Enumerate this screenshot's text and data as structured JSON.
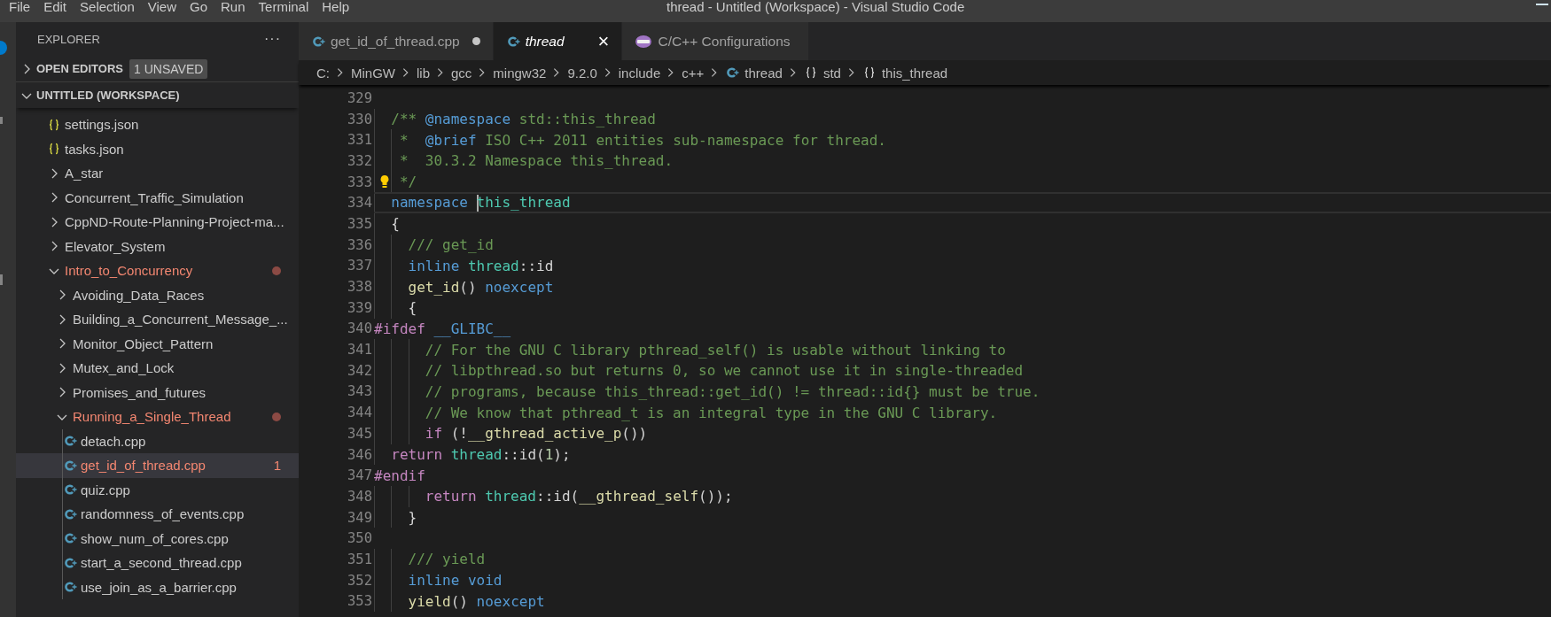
{
  "title_bar": {
    "menu": [
      "File",
      "Edit",
      "Selection",
      "View",
      "Go",
      "Run",
      "Terminal",
      "Help"
    ],
    "title": "thread - Untitled (Workspace) - Visual Studio Code"
  },
  "sidebar": {
    "title": "EXPLORER",
    "more": "···",
    "sections": [
      {
        "label": "OPEN EDITORS",
        "expanded": false,
        "badge": "1 UNSAVED"
      },
      {
        "label": "UNTITLED (WORKSPACE)",
        "expanded": true
      }
    ],
    "tree": [
      {
        "label": "settings.json",
        "kind": "json",
        "selected": false,
        "modified": false
      },
      {
        "label": "tasks.json",
        "kind": "json",
        "selected": false,
        "modified": false
      },
      {
        "label": "A_star",
        "kind": "folder",
        "expanded": false,
        "selected": false,
        "modified": false
      },
      {
        "label": "Concurrent_Traffic_Simulation",
        "kind": "folder",
        "expanded": false,
        "selected": false,
        "modified": false
      },
      {
        "label": "CppND-Route-Planning-Project-ma...",
        "kind": "folder",
        "expanded": false,
        "selected": false,
        "modified": false
      },
      {
        "label": "Elevator_System",
        "kind": "folder",
        "expanded": false,
        "selected": false,
        "modified": false
      },
      {
        "label": "Intro_to_Concurrency",
        "kind": "folder",
        "expanded": true,
        "selected": false,
        "modified": true,
        "children": [
          {
            "label": "Avoiding_Data_Races",
            "kind": "folder",
            "expanded": false,
            "selected": false,
            "modified": false
          },
          {
            "label": "Building_a_Concurrent_Message_...",
            "kind": "folder",
            "expanded": false,
            "selected": false,
            "modified": false
          },
          {
            "label": "Monitor_Object_Pattern",
            "kind": "folder",
            "expanded": false,
            "selected": false,
            "modified": false
          },
          {
            "label": "Mutex_and_Lock",
            "kind": "folder",
            "expanded": false,
            "selected": false,
            "modified": false
          },
          {
            "label": "Promises_and_futures",
            "kind": "folder",
            "expanded": false,
            "selected": false,
            "modified": false
          },
          {
            "label": "Running_a_Single_Thread",
            "kind": "folder",
            "expanded": true,
            "selected": false,
            "modified": true,
            "children": [
              {
                "label": "detach.cpp",
                "kind": "cpp",
                "selected": false,
                "modified": false
              },
              {
                "label": "get_id_of_thread.cpp",
                "kind": "cpp",
                "selected": true,
                "modified": true,
                "badge": "1"
              },
              {
                "label": "quiz.cpp",
                "kind": "cpp",
                "selected": false,
                "modified": false
              },
              {
                "label": "randomness_of_events.cpp",
                "kind": "cpp",
                "selected": false,
                "modified": false
              },
              {
                "label": "show_num_of_cores.cpp",
                "kind": "cpp",
                "selected": false,
                "modified": false
              },
              {
                "label": "start_a_second_thread.cpp",
                "kind": "cpp",
                "selected": false,
                "modified": false
              },
              {
                "label": "use_join_as_a_barrier.cpp",
                "kind": "cpp",
                "selected": false,
                "modified": false
              }
            ]
          }
        ]
      }
    ]
  },
  "tabs": [
    {
      "label": "get_id_of_thread.cpp",
      "kind": "cpp",
      "selected": false,
      "dirty": true,
      "preview": false
    },
    {
      "label": "thread",
      "kind": "cpp",
      "selected": true,
      "dirty": false,
      "preview": true,
      "close": "×"
    },
    {
      "label": "C/C++ Configurations",
      "kind": "config",
      "selected": false,
      "dirty": false,
      "preview": false
    }
  ],
  "breadcrumbs": [
    {
      "label": "C:",
      "kind": "folder"
    },
    {
      "label": "MinGW",
      "kind": "folder"
    },
    {
      "label": "lib",
      "kind": "folder"
    },
    {
      "label": "gcc",
      "kind": "folder"
    },
    {
      "label": "mingw32",
      "kind": "folder"
    },
    {
      "label": "9.2.0",
      "kind": "folder"
    },
    {
      "label": "include",
      "kind": "folder"
    },
    {
      "label": "c++",
      "kind": "folder"
    },
    {
      "label": "thread",
      "kind": "cpp"
    },
    {
      "label": "std",
      "kind": "namespace"
    },
    {
      "label": "this_thread",
      "kind": "namespace"
    }
  ],
  "editor": {
    "lines": [
      {
        "number": "329"
      },
      {
        "number": "330",
        "tokens": [
          {
            "kind": "comment",
            "text": "  /** "
          },
          {
            "kind": "doctag",
            "text": "@namespace"
          },
          {
            "kind": "comment",
            "text": " std::this_thread"
          }
        ]
      },
      {
        "number": "331",
        "tokens": [
          {
            "kind": "comment",
            "text": "   *  "
          },
          {
            "kind": "doctag",
            "text": "@brief"
          },
          {
            "kind": "comment",
            "text": " ISO C++ 2011 entities sub-namespace for thread."
          }
        ]
      },
      {
        "number": "332",
        "tokens": [
          {
            "kind": "comment",
            "text": "   *  30.3.2 Namespace this_thread."
          }
        ]
      },
      {
        "number": "333",
        "lightbulb": true,
        "tokens": [
          {
            "kind": "comment",
            "text": "   */"
          }
        ]
      },
      {
        "number": "334",
        "current": true,
        "tokens": [
          {
            "kind": "keyword",
            "text": "  namespace "
          },
          {
            "kind": "type",
            "text": "this_thread",
            "cursor": true
          }
        ]
      },
      {
        "number": "335",
        "tokens": [
          {
            "kind": "plain",
            "text": "  {"
          }
        ]
      },
      {
        "number": "336",
        "tokens": [
          {
            "kind": "comment",
            "text": "    /// get_id"
          }
        ]
      },
      {
        "number": "337",
        "tokens": [
          {
            "kind": "keyword",
            "text": "    inline "
          },
          {
            "kind": "type",
            "text": "thread"
          },
          {
            "kind": "plain",
            "text": "::id"
          }
        ]
      },
      {
        "number": "338",
        "tokens": [
          {
            "kind": "function",
            "text": "    get_id"
          },
          {
            "kind": "plain",
            "text": "() "
          },
          {
            "kind": "keyword",
            "text": "noexcept"
          }
        ]
      },
      {
        "number": "339",
        "tokens": [
          {
            "kind": "plain",
            "text": "    {"
          }
        ]
      },
      {
        "number": "340",
        "tokens": [
          {
            "kind": "preproc",
            "text": "#ifdef "
          },
          {
            "kind": "macro",
            "text": "__GLIBC__"
          }
        ]
      },
      {
        "number": "341",
        "tokens": [
          {
            "kind": "comment",
            "text": "      // For the GNU C library pthread_self() is usable without linking to"
          }
        ]
      },
      {
        "number": "342",
        "tokens": [
          {
            "kind": "comment",
            "text": "      // libpthread.so but returns 0, so we cannot use it in single-threaded"
          }
        ]
      },
      {
        "number": "343",
        "tokens": [
          {
            "kind": "comment",
            "text": "      // programs, because this_thread::get_id() != thread::id{} must be true."
          }
        ]
      },
      {
        "number": "344",
        "tokens": [
          {
            "kind": "comment",
            "text": "      // We know that pthread_t is an integral type in the GNU C library."
          }
        ]
      },
      {
        "number": "345",
        "tokens": [
          {
            "kind": "control",
            "text": "      if"
          },
          {
            "kind": "plain",
            "text": " (!"
          },
          {
            "kind": "function",
            "text": "__gthread_active_p"
          },
          {
            "kind": "plain",
            "text": "())"
          }
        ]
      },
      {
        "number": "346",
        "tokens": [
          {
            "kind": "control",
            "text": "  return "
          },
          {
            "kind": "type",
            "text": "thread"
          },
          {
            "kind": "plain",
            "text": "::id("
          },
          {
            "kind": "number",
            "text": "1"
          },
          {
            "kind": "plain",
            "text": ");"
          }
        ]
      },
      {
        "number": "347",
        "tokens": [
          {
            "kind": "preproc",
            "text": "#endif"
          }
        ]
      },
      {
        "number": "348",
        "tokens": [
          {
            "kind": "control",
            "text": "      return "
          },
          {
            "kind": "type",
            "text": "thread"
          },
          {
            "kind": "plain",
            "text": "::id("
          },
          {
            "kind": "function",
            "text": "__gthread_self"
          },
          {
            "kind": "plain",
            "text": "());"
          }
        ]
      },
      {
        "number": "349",
        "tokens": [
          {
            "kind": "plain",
            "text": "    }"
          }
        ]
      },
      {
        "number": "350"
      },
      {
        "number": "351",
        "tokens": [
          {
            "kind": "comment",
            "text": "    /// yield"
          }
        ]
      },
      {
        "number": "352",
        "tokens": [
          {
            "kind": "keyword",
            "text": "    inline void"
          }
        ]
      },
      {
        "number": "353",
        "tokens": [
          {
            "kind": "function",
            "text": "    yield"
          },
          {
            "kind": "plain",
            "text": "() "
          },
          {
            "kind": "keyword",
            "text": "noexcept"
          }
        ]
      }
    ]
  }
}
